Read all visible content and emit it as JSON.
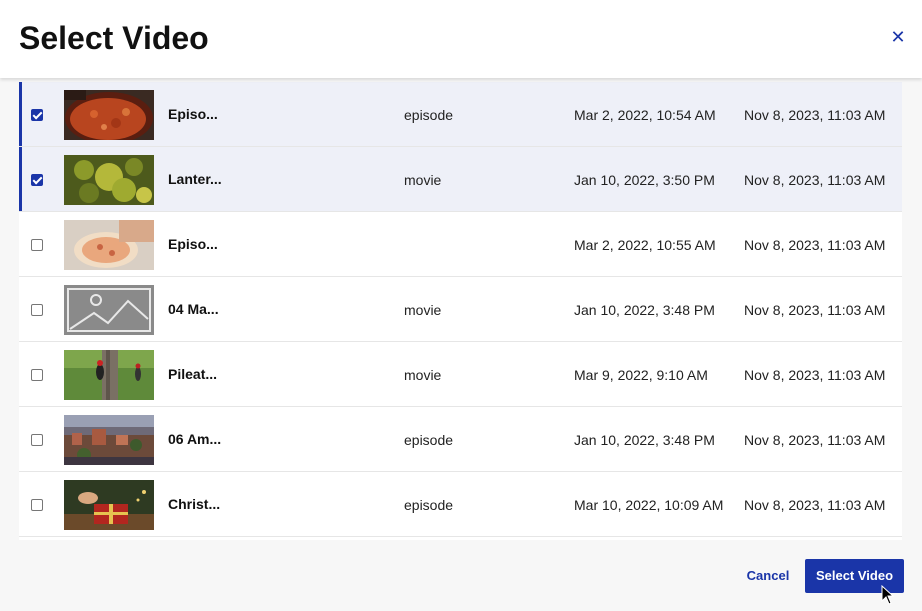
{
  "dialog": {
    "title": "Select Video",
    "close_icon": "close-icon"
  },
  "rows": [
    {
      "name": "Episo...",
      "type": "episode",
      "created": "Mar 2, 2022, 10:54 AM",
      "updated": "Nov 8, 2023, 11:03 AM",
      "checked": true,
      "thumbnail": "food-dish"
    },
    {
      "name": "Lanter...",
      "type": "movie",
      "created": "Jan 10, 2022, 3:50 PM",
      "updated": "Nov 8, 2023, 11:03 AM",
      "checked": true,
      "thumbnail": "yellow-foliage"
    },
    {
      "name": "Episo...",
      "type": "",
      "created": "Mar 2, 2022, 10:55 AM",
      "updated": "Nov 8, 2023, 11:03 AM",
      "checked": false,
      "thumbnail": "pizza-dough"
    },
    {
      "name": "04 Ma...",
      "type": "movie",
      "created": "Jan 10, 2022, 3:48 PM",
      "updated": "Nov 8, 2023, 11:03 AM",
      "checked": false,
      "thumbnail": "image-placeholder"
    },
    {
      "name": "Pileat...",
      "type": "movie",
      "created": "Mar 9, 2022, 9:10 AM",
      "updated": "Nov 8, 2023, 11:03 AM",
      "checked": false,
      "thumbnail": "woodpecker"
    },
    {
      "name": "06 Am...",
      "type": "episode",
      "created": "Jan 10, 2022, 3:48 PM",
      "updated": "Nov 8, 2023, 11:03 AM",
      "checked": false,
      "thumbnail": "city-aerial"
    },
    {
      "name": "Christ...",
      "type": "episode",
      "created": "Mar 10, 2022, 10:09 AM",
      "updated": "Nov 8, 2023, 11:03 AM",
      "checked": false,
      "thumbnail": "gift-box"
    }
  ],
  "footer": {
    "cancel_label": "Cancel",
    "select_label": "Select Video"
  },
  "colors": {
    "accent": "#1a35a8",
    "selected_row": "#eef0f8"
  }
}
